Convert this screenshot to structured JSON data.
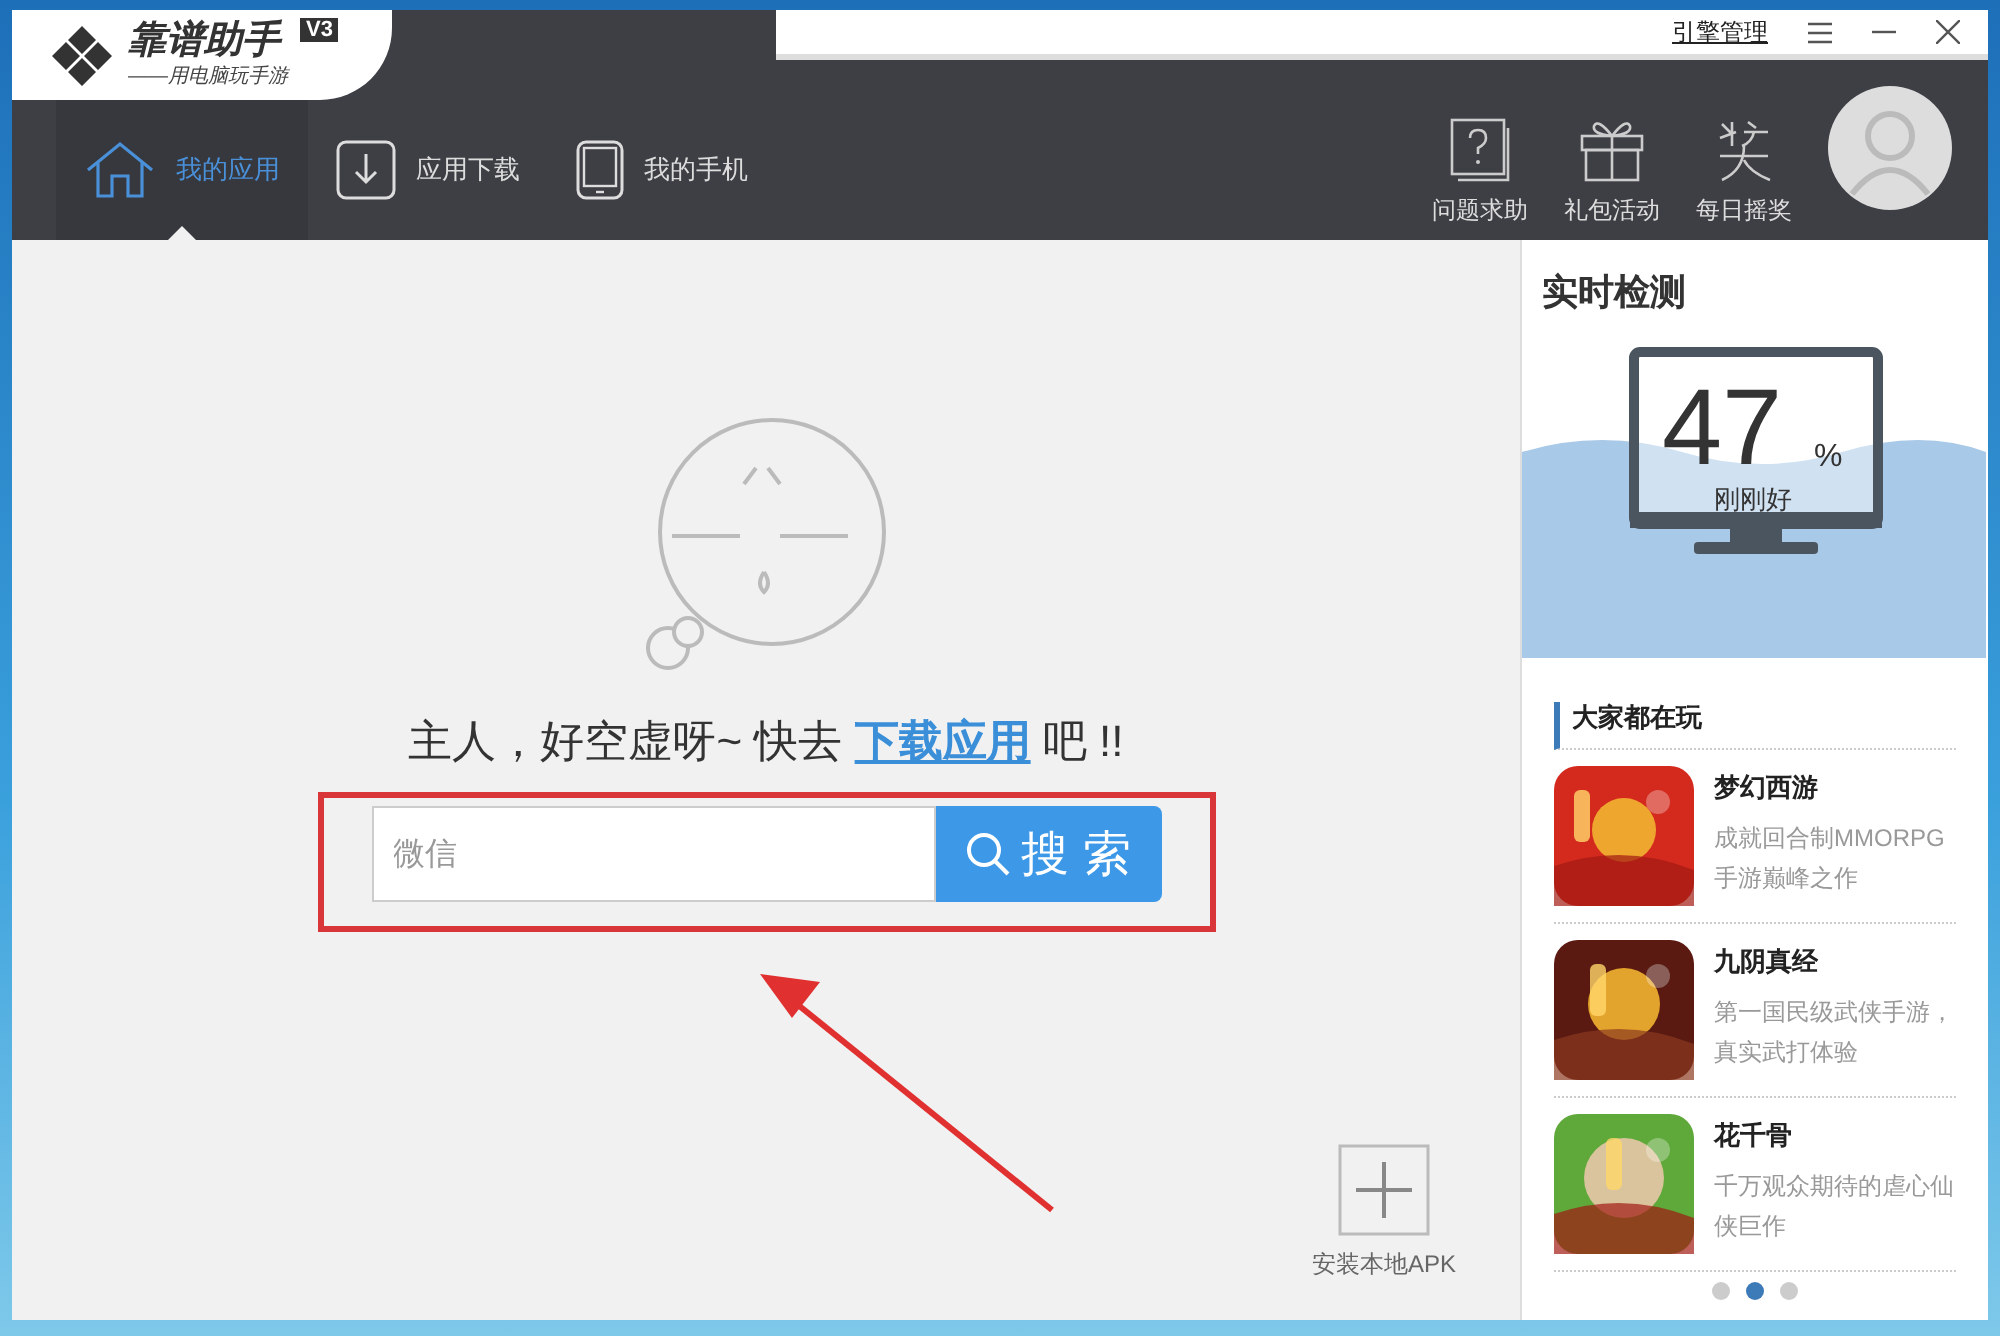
{
  "logo": {
    "title": "靠谱助手",
    "badge": "V3",
    "slogan": "——用电脑玩手游"
  },
  "title_bar": {
    "link": "引擎管理"
  },
  "tabs": [
    {
      "label": "我的应用",
      "kind": "house",
      "selected": true
    },
    {
      "label": "应用下载",
      "kind": "download",
      "selected": false
    },
    {
      "label": "我的手机",
      "kind": "phone",
      "selected": false
    }
  ],
  "actions": [
    {
      "label": "问题求助",
      "kind": "help"
    },
    {
      "label": "礼包活动",
      "kind": "gift"
    },
    {
      "label": "每日摇奖",
      "kind": "prize"
    }
  ],
  "empty_state": {
    "before": "主人，好空虚呀~ 快去",
    "link": "下载应用",
    "after": "吧 !!"
  },
  "search": {
    "value": "微信",
    "button": "搜 索"
  },
  "install": {
    "label": "安装本地APK"
  },
  "monitor": {
    "title": "实时检测",
    "value": "47",
    "unit": "%",
    "status": "刚刚好"
  },
  "popular": {
    "title": "大家都在玩",
    "games": [
      {
        "name": "梦幻西游",
        "description": "成就回合制MMORPG手游巅峰之作"
      },
      {
        "name": "九阴真经",
        "description": "第一国民级武侠手游，真实武打体验"
      },
      {
        "name": "花千骨",
        "description": "千万观众期待的虐心仙侠巨作"
      }
    ],
    "dots": [
      {
        "selected": false
      },
      {
        "selected": true
      },
      {
        "selected": false
      }
    ]
  }
}
